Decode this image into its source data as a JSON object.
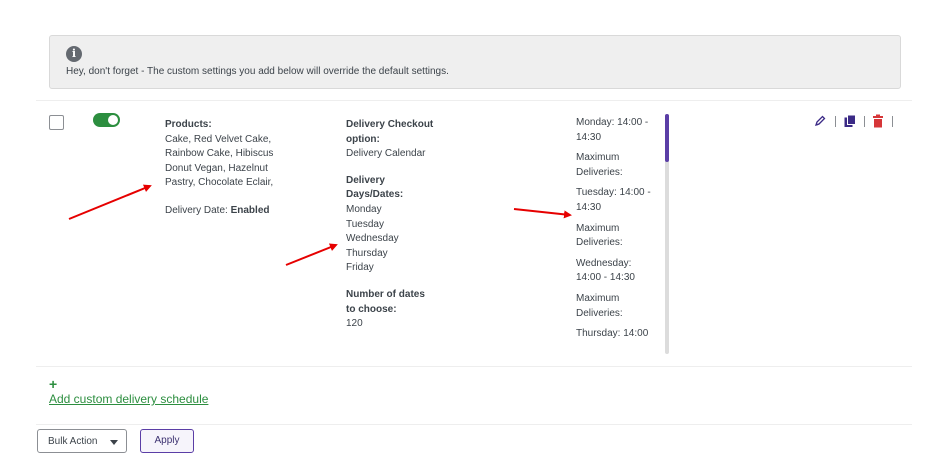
{
  "notice": {
    "message": "Hey, don't forget - The custom settings you add below will override the default settings."
  },
  "schedule_row": {
    "enabled": true,
    "products_label": "Products:",
    "products_lines": [
      "Cake, Red Velvet Cake,",
      "Rainbow Cake, Hibiscus",
      "Donut Vegan, Hazelnut",
      "Pastry, Chocolate Eclair,"
    ],
    "delivery_date_label": "Delivery Date:",
    "delivery_date_value": "Enabled",
    "checkout_option_label_1": "Delivery Checkout",
    "checkout_option_label_2": "option:",
    "checkout_option_value": "Delivery Calendar",
    "days_label_1": "Delivery",
    "days_label_2": "Days/Dates:",
    "days": [
      "Monday",
      "Tuesday",
      "Wednesday",
      "Thursday",
      "Friday"
    ],
    "num_dates_label_1": "Number of dates",
    "num_dates_label_2": "to choose:",
    "num_dates_value": "120",
    "time_slots": [
      {
        "line1": "Monday: 14:00 -",
        "line2": "14:30",
        "max1": "Maximum",
        "max2": "Deliveries:"
      },
      {
        "line1": "Tuesday: 14:00 -",
        "line2": "14:30",
        "max1": "Maximum",
        "max2": "Deliveries:"
      },
      {
        "line1": "Wednesday:",
        "line2": "14:00 - 14:30",
        "max1": "Maximum",
        "max2": "Deliveries:"
      },
      {
        "line1": "Thursday: 14:00",
        "line2": "",
        "max1": "",
        "max2": ""
      }
    ],
    "scroll_position": 0.0
  },
  "add_schedule": {
    "plus": "+",
    "label": "Add custom delivery schedule"
  },
  "bulk_action": {
    "label": "Bulk Action"
  },
  "apply_button": {
    "label": "Apply"
  },
  "colors": {
    "toggle_on": "#2c8e3f",
    "accent_purple": "#5b3ea6",
    "delete_red": "#d63638",
    "arrow_red": "#e60000",
    "link_green": "#2c8e3f"
  },
  "icons": {
    "info": "info-icon",
    "edit": "pencil-icon",
    "duplicate": "copy-icon",
    "delete": "trash-icon",
    "dropdown": "chevron-down-icon"
  }
}
